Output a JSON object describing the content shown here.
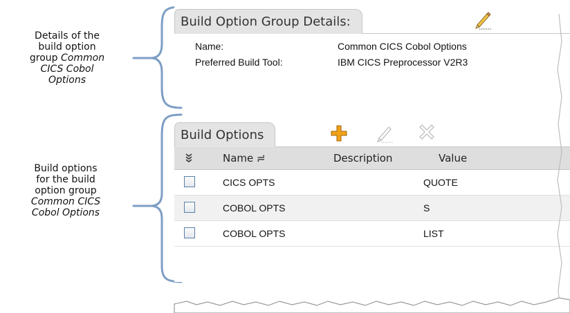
{
  "annotations": {
    "details_lines": [
      "Details of the",
      "build option"
    ],
    "details_prefix": "group ",
    "details_italic_1": "Common",
    "details_italic_2": "CICS Cobol",
    "details_italic_3": "Options",
    "options_lines": [
      "Build options",
      "for the build",
      "option group"
    ],
    "options_italic_1": "Common CICS",
    "options_italic_2": "Cobol Options"
  },
  "details_panel": {
    "tab_label": "Build Option Group Details:",
    "edit_icon": "pencil-icon",
    "name_label": "Name:",
    "name_value": "Common CICS Cobol Options",
    "tool_label": "Preferred Build Tool:",
    "tool_value": "IBM CICS Preprocessor V2R3"
  },
  "options_panel": {
    "tab_label": "Build Options",
    "add_icon": "plus-icon",
    "edit_icon": "pencil-icon",
    "delete_icon": "x-icon",
    "columns": {
      "select_icon": "chevrons-down-icon",
      "name": "Name ≓",
      "description": "Description",
      "value": "Value"
    },
    "rows": [
      {
        "name": "CICS OPTS",
        "description": "",
        "value": "QUOTE"
      },
      {
        "name": "COBOL OPTS",
        "description": "",
        "value": "S"
      },
      {
        "name": "COBOL OPTS",
        "description": "",
        "value": "LIST"
      }
    ]
  },
  "colors": {
    "bracket": "#7d9ec4",
    "tab_bg": "#e4e4e4",
    "header_bg": "#dedede",
    "row_alt": "#f1f1f1",
    "add_icon": "#f0a21a"
  }
}
